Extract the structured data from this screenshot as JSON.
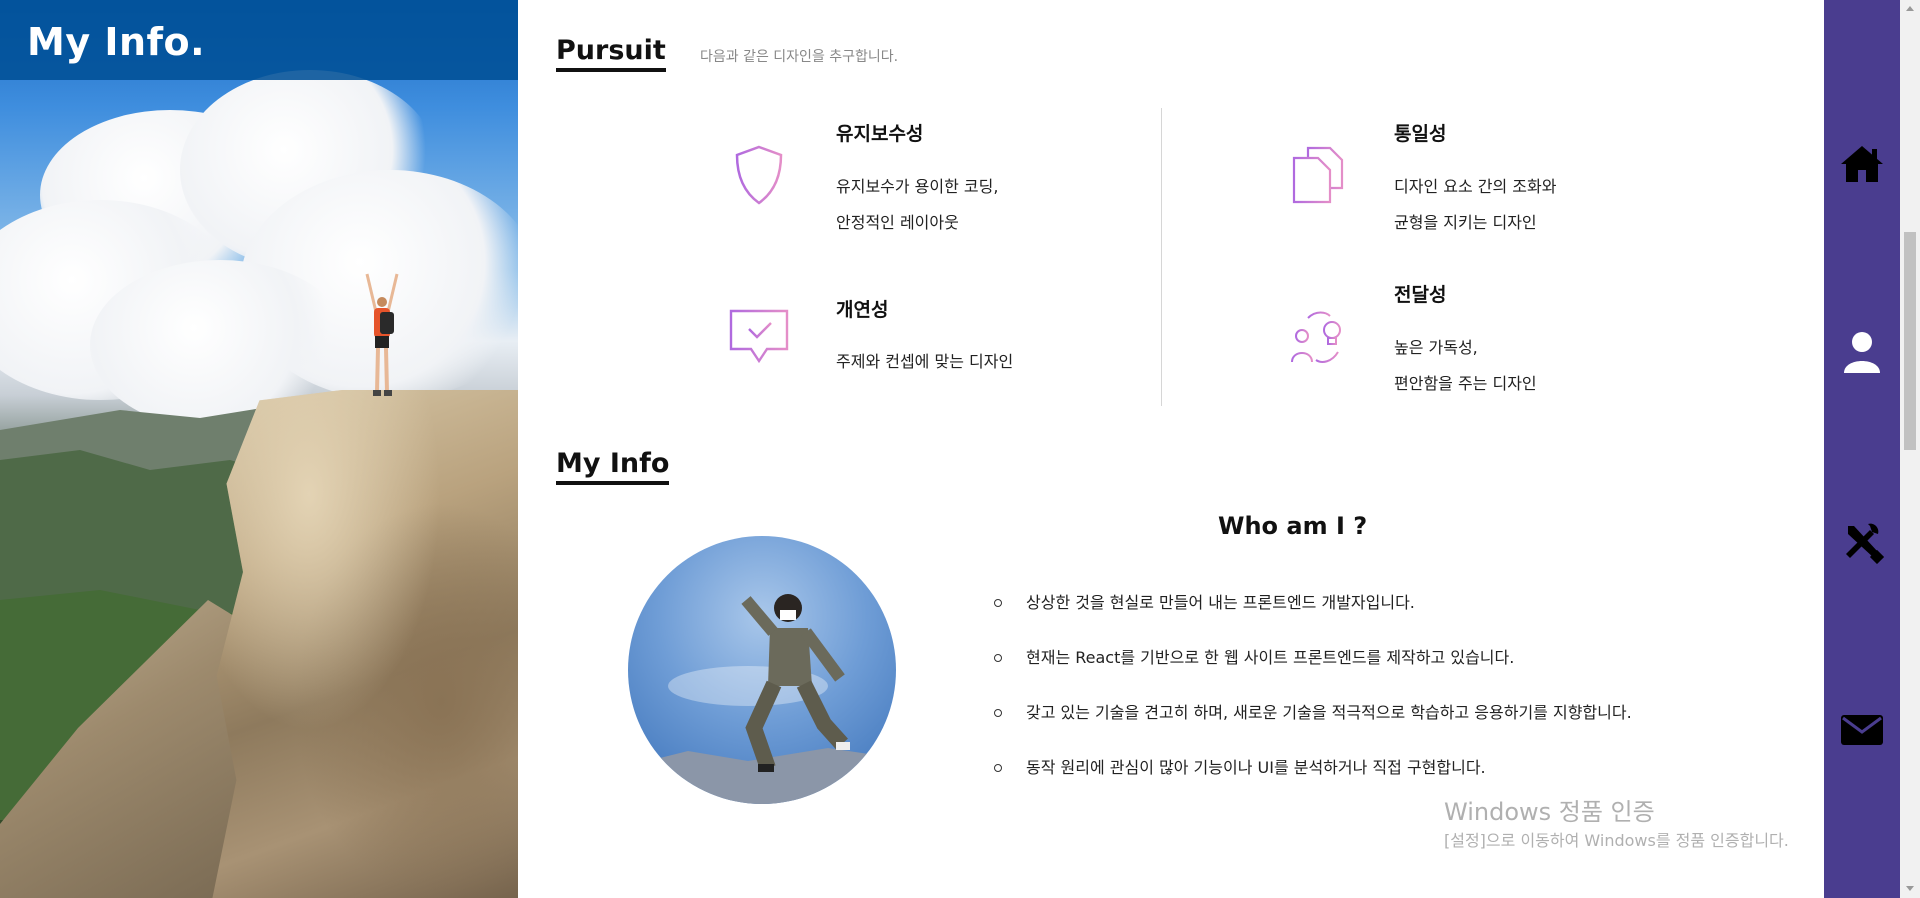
{
  "left_panel": {
    "title": "My Info."
  },
  "pursuit": {
    "heading": "Pursuit",
    "subtitle": "다음과 같은 디자인을 추구합니다.",
    "cards": [
      {
        "icon": "shield-icon",
        "title": "유지보수성",
        "lines": [
          "유지보수가 용이한 코딩,",
          "안정적인 레이아웃"
        ]
      },
      {
        "icon": "documents-icon",
        "title": "통일성",
        "lines": [
          "디자인 요소 간의 조화와",
          "균형을 지키는 디자인"
        ]
      },
      {
        "icon": "chat-check-icon",
        "title": "개연성",
        "lines": [
          "주제와 컨셉에 맞는 디자인"
        ]
      },
      {
        "icon": "idea-exchange-icon",
        "title": "전달성",
        "lines": [
          "높은 가독성,",
          "편안함을 주는 디자인"
        ]
      }
    ]
  },
  "my_info": {
    "heading": "My Info",
    "who_title": "Who am I ?",
    "bullets": [
      "상상한 것을 현실로 만들어 내는 프론트엔드 개발자입니다.",
      "현재는 React를 기반으로 한 웹 사이트 프론트엔드를 제작하고 있습니다.",
      "갖고 있는 기술을 견고히 하며, 새로운 기술을 적극적으로 학습하고 응용하기를 지향합니다.",
      "동작 원리에 관심이 많아 기능이나 UI를 분석하거나 직접 구현합니다."
    ]
  },
  "watermark": {
    "line1": "Windows 정품 인증",
    "line2": "[설정]으로 이동하여 Windows를 정품 인증합니다."
  },
  "nav": [
    "home-icon",
    "user-icon",
    "tools-icon",
    "mail-icon"
  ],
  "colors": {
    "nav_bg": "#4a3d8f",
    "icon_accent": "#c77dd8",
    "header_bg": "#005096"
  }
}
